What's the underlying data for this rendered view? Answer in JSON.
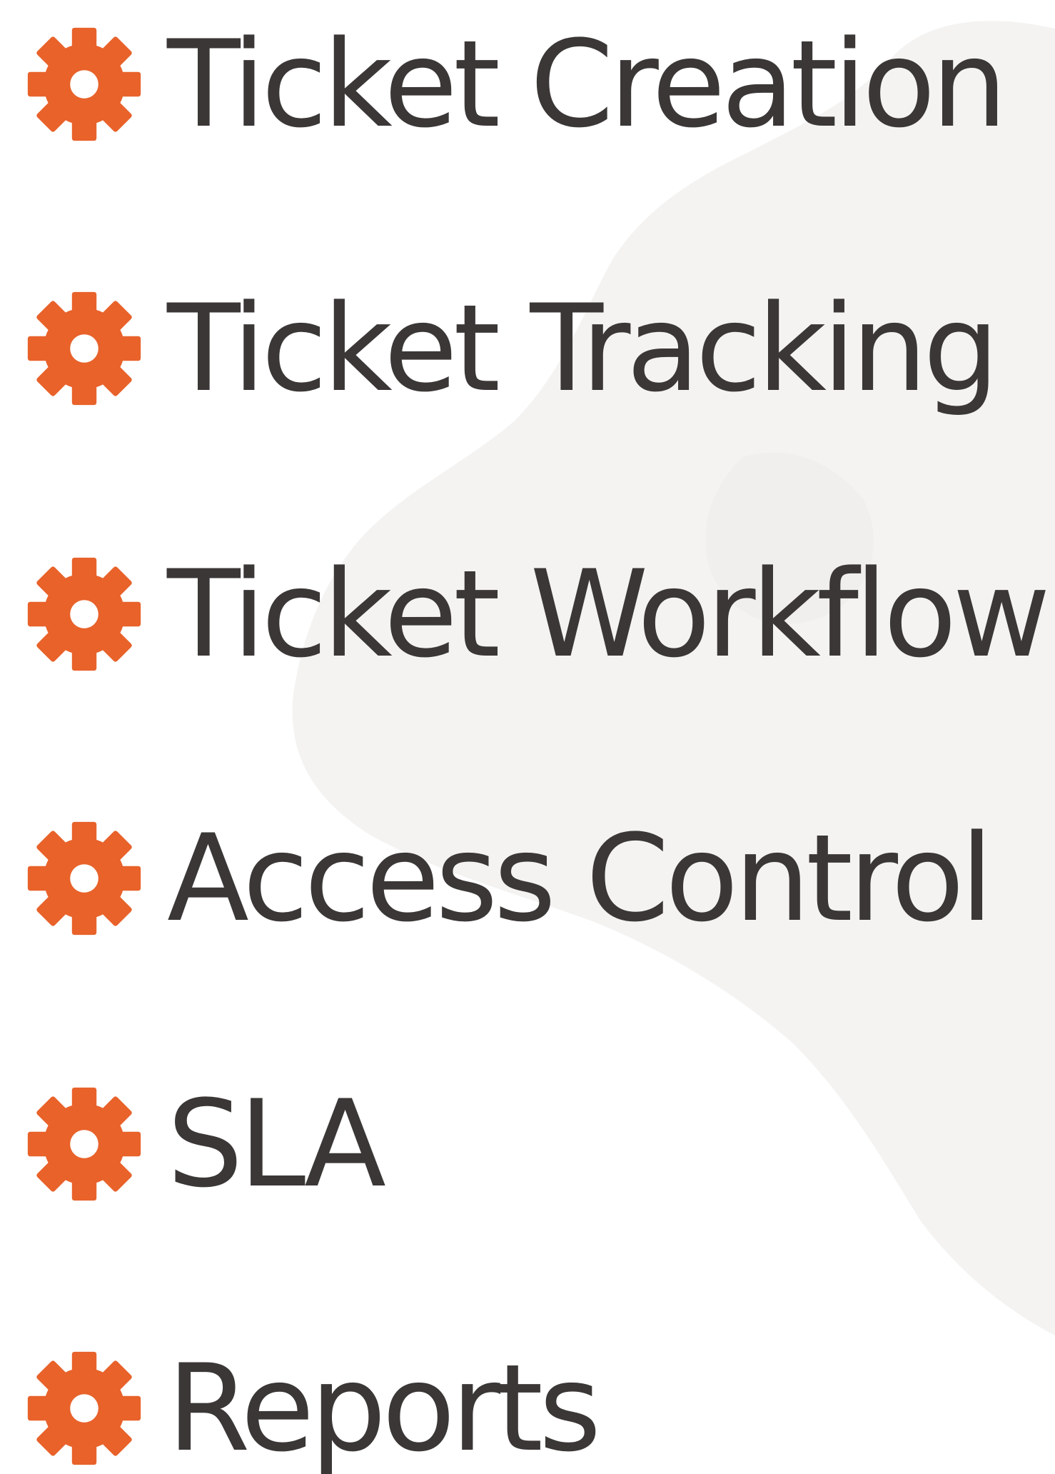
{
  "colors": {
    "accent": "#E8622A",
    "text": "#3A3736",
    "background": "#FFFFFF",
    "map_tint": "#F4F3F2"
  },
  "icon": "gear-icon",
  "features": [
    {
      "label": "Ticket Creation"
    },
    {
      "label": "Ticket Tracking"
    },
    {
      "label": "Ticket Workflow"
    },
    {
      "label": "Access Control"
    },
    {
      "label": "SLA"
    },
    {
      "label": "Reports"
    }
  ]
}
